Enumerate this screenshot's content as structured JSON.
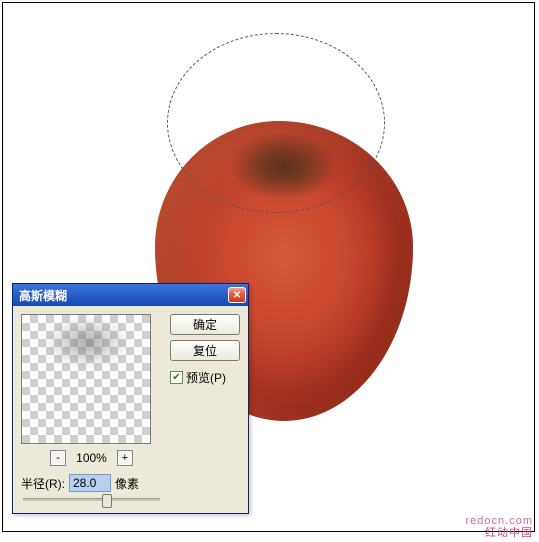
{
  "dialog": {
    "title": "高斯模糊",
    "ok_label": "确定",
    "reset_label": "复位",
    "preview_label": "预览(P)",
    "preview_checked": true,
    "zoom_minus": "-",
    "zoom_plus": "+",
    "zoom_value": "100%",
    "radius_label": "半径(R):",
    "radius_value": "28.0",
    "radius_unit": "像素"
  },
  "watermark": {
    "en": "redocn.com",
    "cn": "红动中国"
  }
}
